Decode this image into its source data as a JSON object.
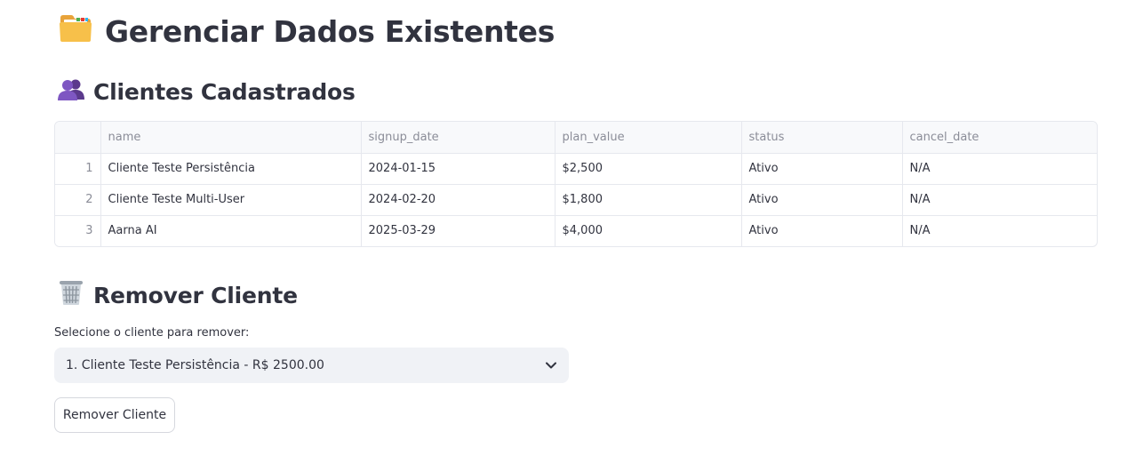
{
  "page": {
    "title": "Gerenciar Dados Existentes",
    "title_icon": "folder-icon"
  },
  "clients_section": {
    "heading": "Clientes Cadastrados",
    "heading_icon": "users-icon",
    "table": {
      "columns": [
        "name",
        "signup_date",
        "plan_value",
        "status",
        "cancel_date"
      ],
      "rows": [
        {
          "index": "1",
          "name": "Cliente Teste Persistência",
          "signup_date": "2024-01-15",
          "plan_value": "$2,500",
          "status": "Ativo",
          "cancel_date": "N/A"
        },
        {
          "index": "2",
          "name": "Cliente Teste Multi-User",
          "signup_date": "2024-02-20",
          "plan_value": "$1,800",
          "status": "Ativo",
          "cancel_date": "N/A"
        },
        {
          "index": "3",
          "name": "Aarna AI",
          "signup_date": "2025-03-29",
          "plan_value": "$4,000",
          "status": "Ativo",
          "cancel_date": "N/A"
        }
      ]
    }
  },
  "remove_section": {
    "heading": "Remover Cliente",
    "heading_icon": "wastebasket-icon",
    "select_label": "Selecione o cliente para remover:",
    "selected_value": "1. Cliente Teste Persistência - R$ 2500.00",
    "button_label": "Remover Cliente"
  },
  "colors": {
    "text": "#31333f",
    "muted": "#8b8d98",
    "select_bg": "#f0f2f6",
    "border": "#e6e8ee"
  }
}
